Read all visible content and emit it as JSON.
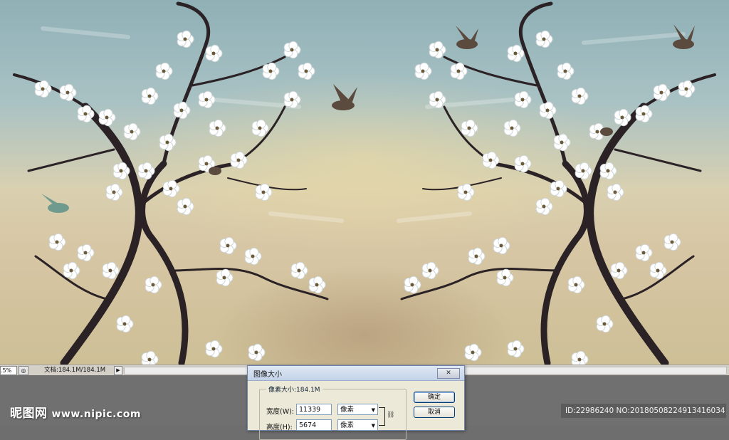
{
  "statusbar": {
    "zoom": ".5%",
    "doc_info": "文档:184.1M/184.1M"
  },
  "dialog": {
    "title": "图像大小",
    "close_glyph": "✕",
    "pixel_dimensions_label": "像素大小:184.1M",
    "width_label": "宽度(W):",
    "width_value": "11339",
    "width_unit": "像素",
    "height_label": "高度(H):",
    "height_value": "5674",
    "height_unit": "像素",
    "ok_label": "确定",
    "cancel_label": "取消"
  },
  "watermark": {
    "brand": "昵图网",
    "url": "www.nipic.com"
  },
  "image_id": "ID:22986240 NO:20180508224913416034",
  "icons": {
    "zoom_button": "nav-icon",
    "arrow": "triangle-right-icon",
    "chain": "link-icon"
  },
  "colors": {
    "dialog_bg": "#ece9d8",
    "button_border": "#003c74",
    "canvas_sky": "#8fb0b6"
  }
}
